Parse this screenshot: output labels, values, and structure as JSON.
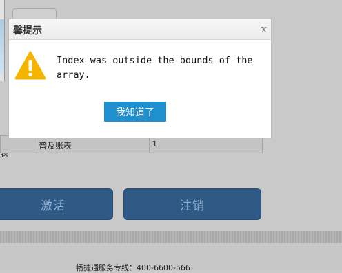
{
  "dialog": {
    "title": "温馨提示",
    "title_visible": "馨提示",
    "close_label": "x",
    "icon": "warning-icon",
    "message": "Index was outside the bounds of the array.",
    "ok_label": "我知道了"
  },
  "background": {
    "side_glyph": "表",
    "table_row": {
      "name": "普及账表",
      "value": "1"
    },
    "activate_label": "激活",
    "logout_label": "注销",
    "hotline": "畅捷通服务专线：400-6600-566"
  },
  "colors": {
    "primary_button": "#1e8fcf",
    "dark_button": "#2f5a86",
    "warning": "#f5b400"
  }
}
